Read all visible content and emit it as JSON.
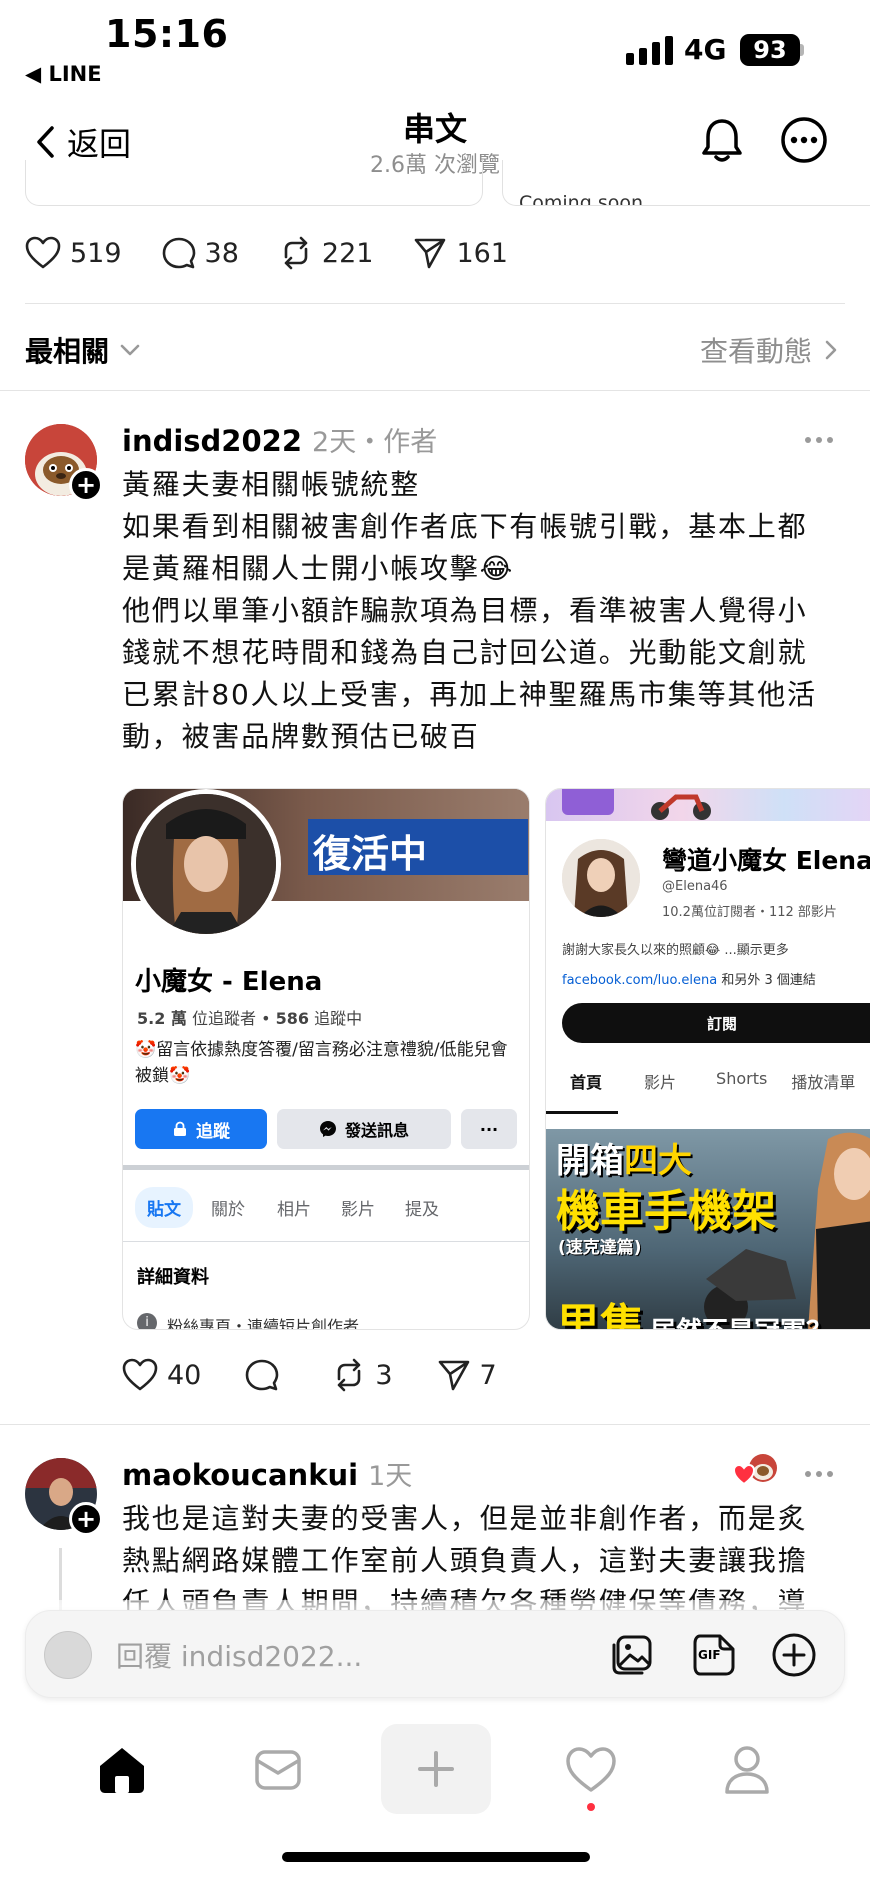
{
  "status": {
    "time": "15:16",
    "back_app": "◀ LINE",
    "network": "4G",
    "battery": "93"
  },
  "nav": {
    "back_label": "返回",
    "title": "串文",
    "subtitle": "2.6萬 次瀏覽"
  },
  "top_card": {
    "right_text": "Coming soon"
  },
  "main_actions": {
    "likes": "519",
    "comments": "38",
    "reposts": "221",
    "shares": "161"
  },
  "sort": {
    "label": "最相關",
    "activity": "查看動態"
  },
  "reply1": {
    "username": "indisd2022",
    "meta": "2天・作者",
    "lines": [
      "黃羅夫妻相關帳號統整",
      "如果看到相關被害創作者底下有帳號引戰，基本上都",
      "是黃羅相關人士開小帳攻擊😂",
      "他們以單筆小額詐騙款項為目標，看準被害人覺得小",
      "錢就不想花時間和錢為自己討回公道。光動能文創就",
      "已累計80人以上受害，再加上神聖羅馬市集等其他活",
      "動，被害品牌數預估已破百"
    ],
    "actions": {
      "likes": "40",
      "comments": "",
      "reposts": "3",
      "shares": "7"
    }
  },
  "fb_card": {
    "banner_text": "復活中",
    "name": "小魔女 - Elena",
    "followers_num": "5.2 萬",
    "followers_label": " 位追蹤者 • ",
    "following_num": "586",
    "following_label": " 追蹤中",
    "bio": "🤡留言依據熱度答覆/留言務必注意禮貌/低能兒會被鎖🤡",
    "follow_button": "追蹤",
    "message_button": "發送訊息",
    "more_button": "···",
    "tabs": [
      "貼文",
      "關於",
      "相片",
      "影片",
      "提及"
    ],
    "details_title": "詳細資料",
    "details_line": "粉絲專頁・連續短片創作者"
  },
  "yt_card": {
    "channel_name": "彎道小魔女 Elena",
    "handle": "@Elena46",
    "stats": "10.2萬位訂閱者・112 部影片",
    "description": "謝謝大家長久以來的照顧😂 ...顯示更多",
    "link": "facebook.com/luo.elena",
    "link_suffix": " 和另外 3 個連結",
    "subscribe_button": "訂閱",
    "tabs": [
      "首頁",
      "影片",
      "Shorts",
      "播放清單"
    ],
    "thumb_line1a": "開箱",
    "thumb_line1b": "四大",
    "thumb_line2": "機車手機架",
    "thumb_line3": "(速克達篇)",
    "thumb_line4": "里隼",
    "thumb_line4b": "居然不是冠軍？"
  },
  "reply2": {
    "username": "maokoucankui",
    "meta": "1天",
    "lines": [
      "我也是這對夫妻的受害人，但是並非創作者，而是炙",
      "熱點網路媒體工作室前人頭負責人，這對夫妻讓我擔",
      "任人頭負責人期間，持續積欠各種勞健保等債務，導"
    ]
  },
  "composer": {
    "placeholder": "回覆 indisd2022...",
    "gif_label": "GIF"
  },
  "colors": {
    "accent": "#000000",
    "muted": "#8e8e8e",
    "fb_blue": "#1877f2",
    "notif_red": "#ff3040"
  }
}
